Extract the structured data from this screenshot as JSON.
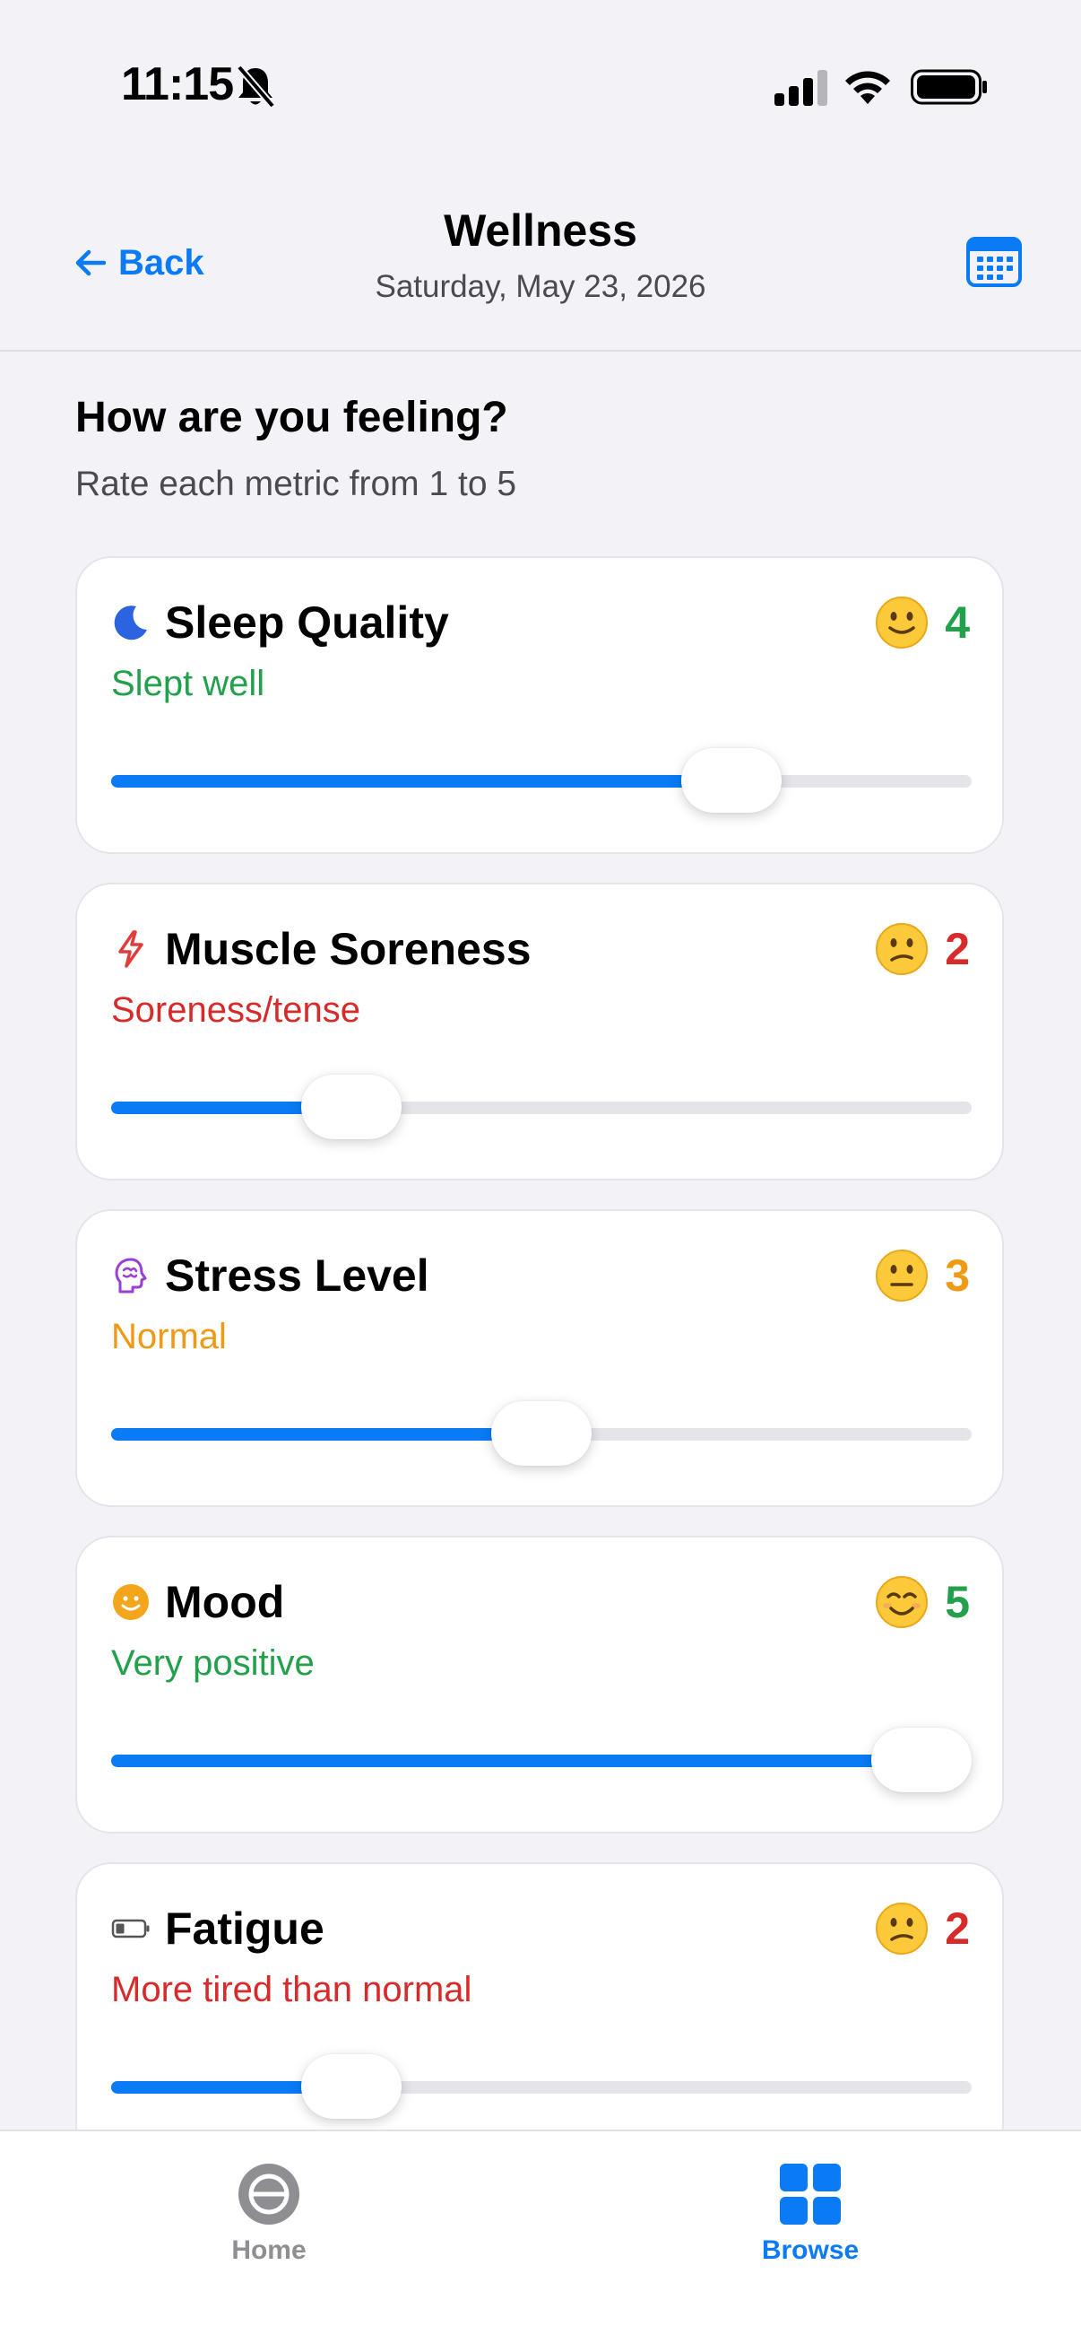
{
  "status_bar": {
    "time": "11:15"
  },
  "header": {
    "back_label": "Back",
    "title": "Wellness",
    "date": "Saturday, May 23, 2026"
  },
  "intro": {
    "title": "How are you feeling?",
    "subtitle": "Rate each metric from 1 to 5"
  },
  "metrics": [
    {
      "title": "Sleep Quality",
      "icon": "moon-icon",
      "score": "4",
      "description": "Slept well",
      "color": "#22a04b",
      "level": 0.75
    },
    {
      "title": "Muscle Soreness",
      "icon": "bolt-icon",
      "score": "2",
      "description": "Soreness/tense",
      "color": "#d72a2a",
      "level": 0.25
    },
    {
      "title": "Stress Level",
      "icon": "brain-icon",
      "score": "3",
      "description": "Normal",
      "color": "#ee9a14",
      "level": 0.5
    },
    {
      "title": "Mood",
      "icon": "smiley-icon",
      "score": "5",
      "description": "Very positive",
      "color": "#22a04b",
      "level": 1.0
    },
    {
      "title": "Fatigue",
      "icon": "battery-low-icon",
      "score": "2",
      "description": "More tired than normal",
      "color": "#d72a2a",
      "level": 0.25
    }
  ],
  "tabs": {
    "home_label": "Home",
    "browse_label": "Browse",
    "active": "Browse"
  },
  "colors": {
    "accent": "#0a7bf5",
    "good": "#22a04b",
    "bad": "#d72a2a",
    "neutral": "#ee9a14"
  }
}
